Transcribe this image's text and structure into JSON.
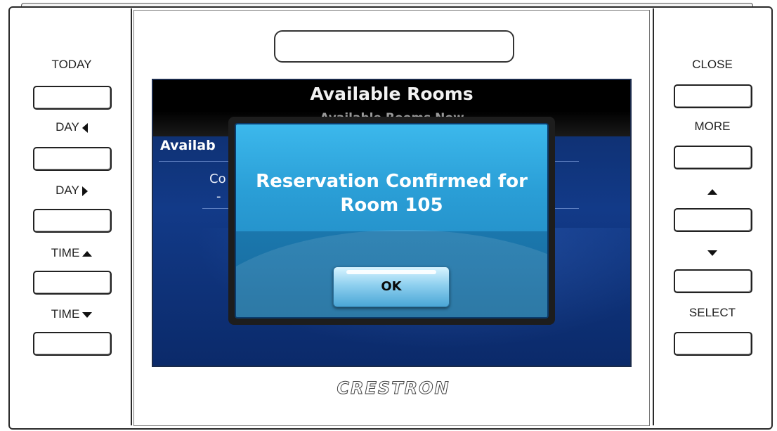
{
  "left_panel": {
    "today_label": "TODAY",
    "day_prev_label": "DAY",
    "day_next_label": "DAY",
    "time_up_label": "TIME",
    "time_down_label": "TIME"
  },
  "right_panel": {
    "close_label": "CLOSE",
    "more_label": "MORE",
    "select_label": "SELECT"
  },
  "screen": {
    "title": "Available Rooms",
    "subtitle": "Available Rooms Now",
    "section_label": "Availab",
    "row_text": "Co",
    "row_dash": "-"
  },
  "dialog": {
    "message_line1": "Reservation Confirmed for",
    "message_line2": "Room 105",
    "ok_label": "OK"
  },
  "brand": {
    "logo_text": "CRESTRON"
  },
  "colors": {
    "screen_blue": "#123a88",
    "dialog_blue": "#2a9ed6",
    "header_black": "#000000"
  }
}
